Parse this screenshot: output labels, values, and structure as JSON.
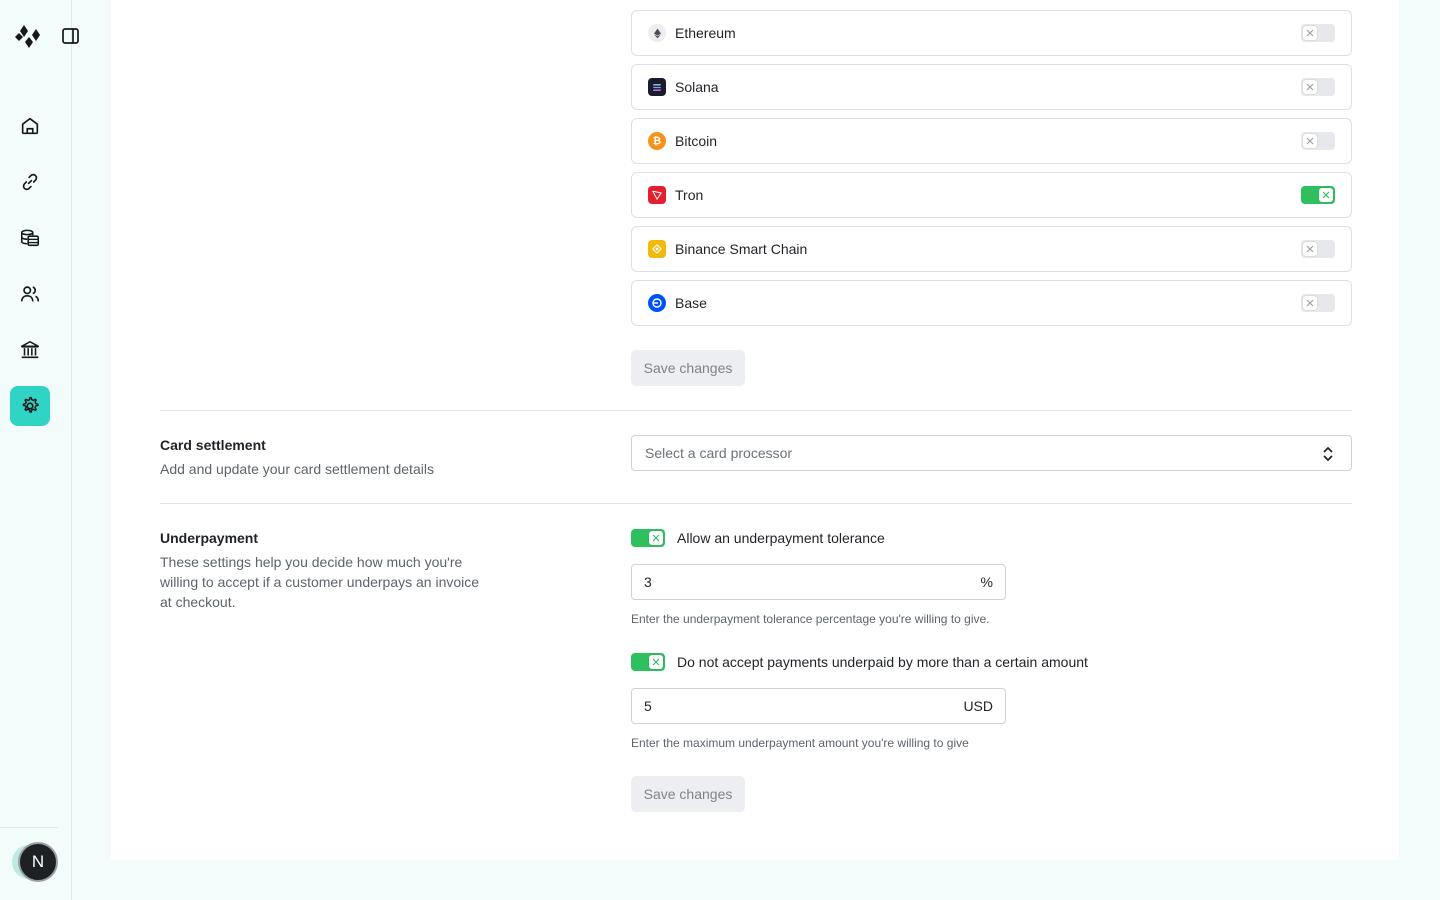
{
  "sidebar": {
    "items": [
      {
        "name": "home",
        "icon": "home-icon"
      },
      {
        "name": "links",
        "icon": "link-icon"
      },
      {
        "name": "payments",
        "icon": "coins-icon"
      },
      {
        "name": "customers",
        "icon": "users-icon"
      },
      {
        "name": "bank",
        "icon": "bank-icon"
      },
      {
        "name": "settings",
        "icon": "gear-icon",
        "active": true
      }
    ],
    "avatar_initial": "N"
  },
  "chains": {
    "items": [
      {
        "label": "Ethereum",
        "enabled": false,
        "color": "#eceef1"
      },
      {
        "label": "Solana",
        "enabled": false,
        "color": "#1b1b2e"
      },
      {
        "label": "Bitcoin",
        "enabled": false,
        "color": "#f7931a"
      },
      {
        "label": "Tron",
        "enabled": true,
        "color": "#e5202e"
      },
      {
        "label": "Binance Smart Chain",
        "enabled": false,
        "color": "#f0b90b"
      },
      {
        "label": "Base",
        "enabled": false,
        "color": "#0052ff"
      }
    ],
    "save_label": "Save changes"
  },
  "card_settlement": {
    "title": "Card settlement",
    "description": "Add and update your card settlement details",
    "select_placeholder": "Select a card processor"
  },
  "underpayment": {
    "title": "Underpayment",
    "description": "These settings help you decide how much you're willing to accept if a customer underpays an invoice at checkout.",
    "tolerance_label": "Allow an underpayment tolerance",
    "tolerance_enabled": true,
    "tolerance_value": "3",
    "tolerance_suffix": "%",
    "tolerance_hint": "Enter the underpayment tolerance percentage you're willing to give.",
    "max_label": "Do not accept payments underpaid by more than a certain amount",
    "max_enabled": true,
    "max_value": "5",
    "max_suffix": "USD",
    "max_hint": "Enter the maximum underpayment amount you're willing to give",
    "save_label": "Save changes"
  },
  "colors": {
    "accent": "#2fd4c4",
    "toggle_on": "#2ec05f",
    "background": "#f2fcfa"
  }
}
